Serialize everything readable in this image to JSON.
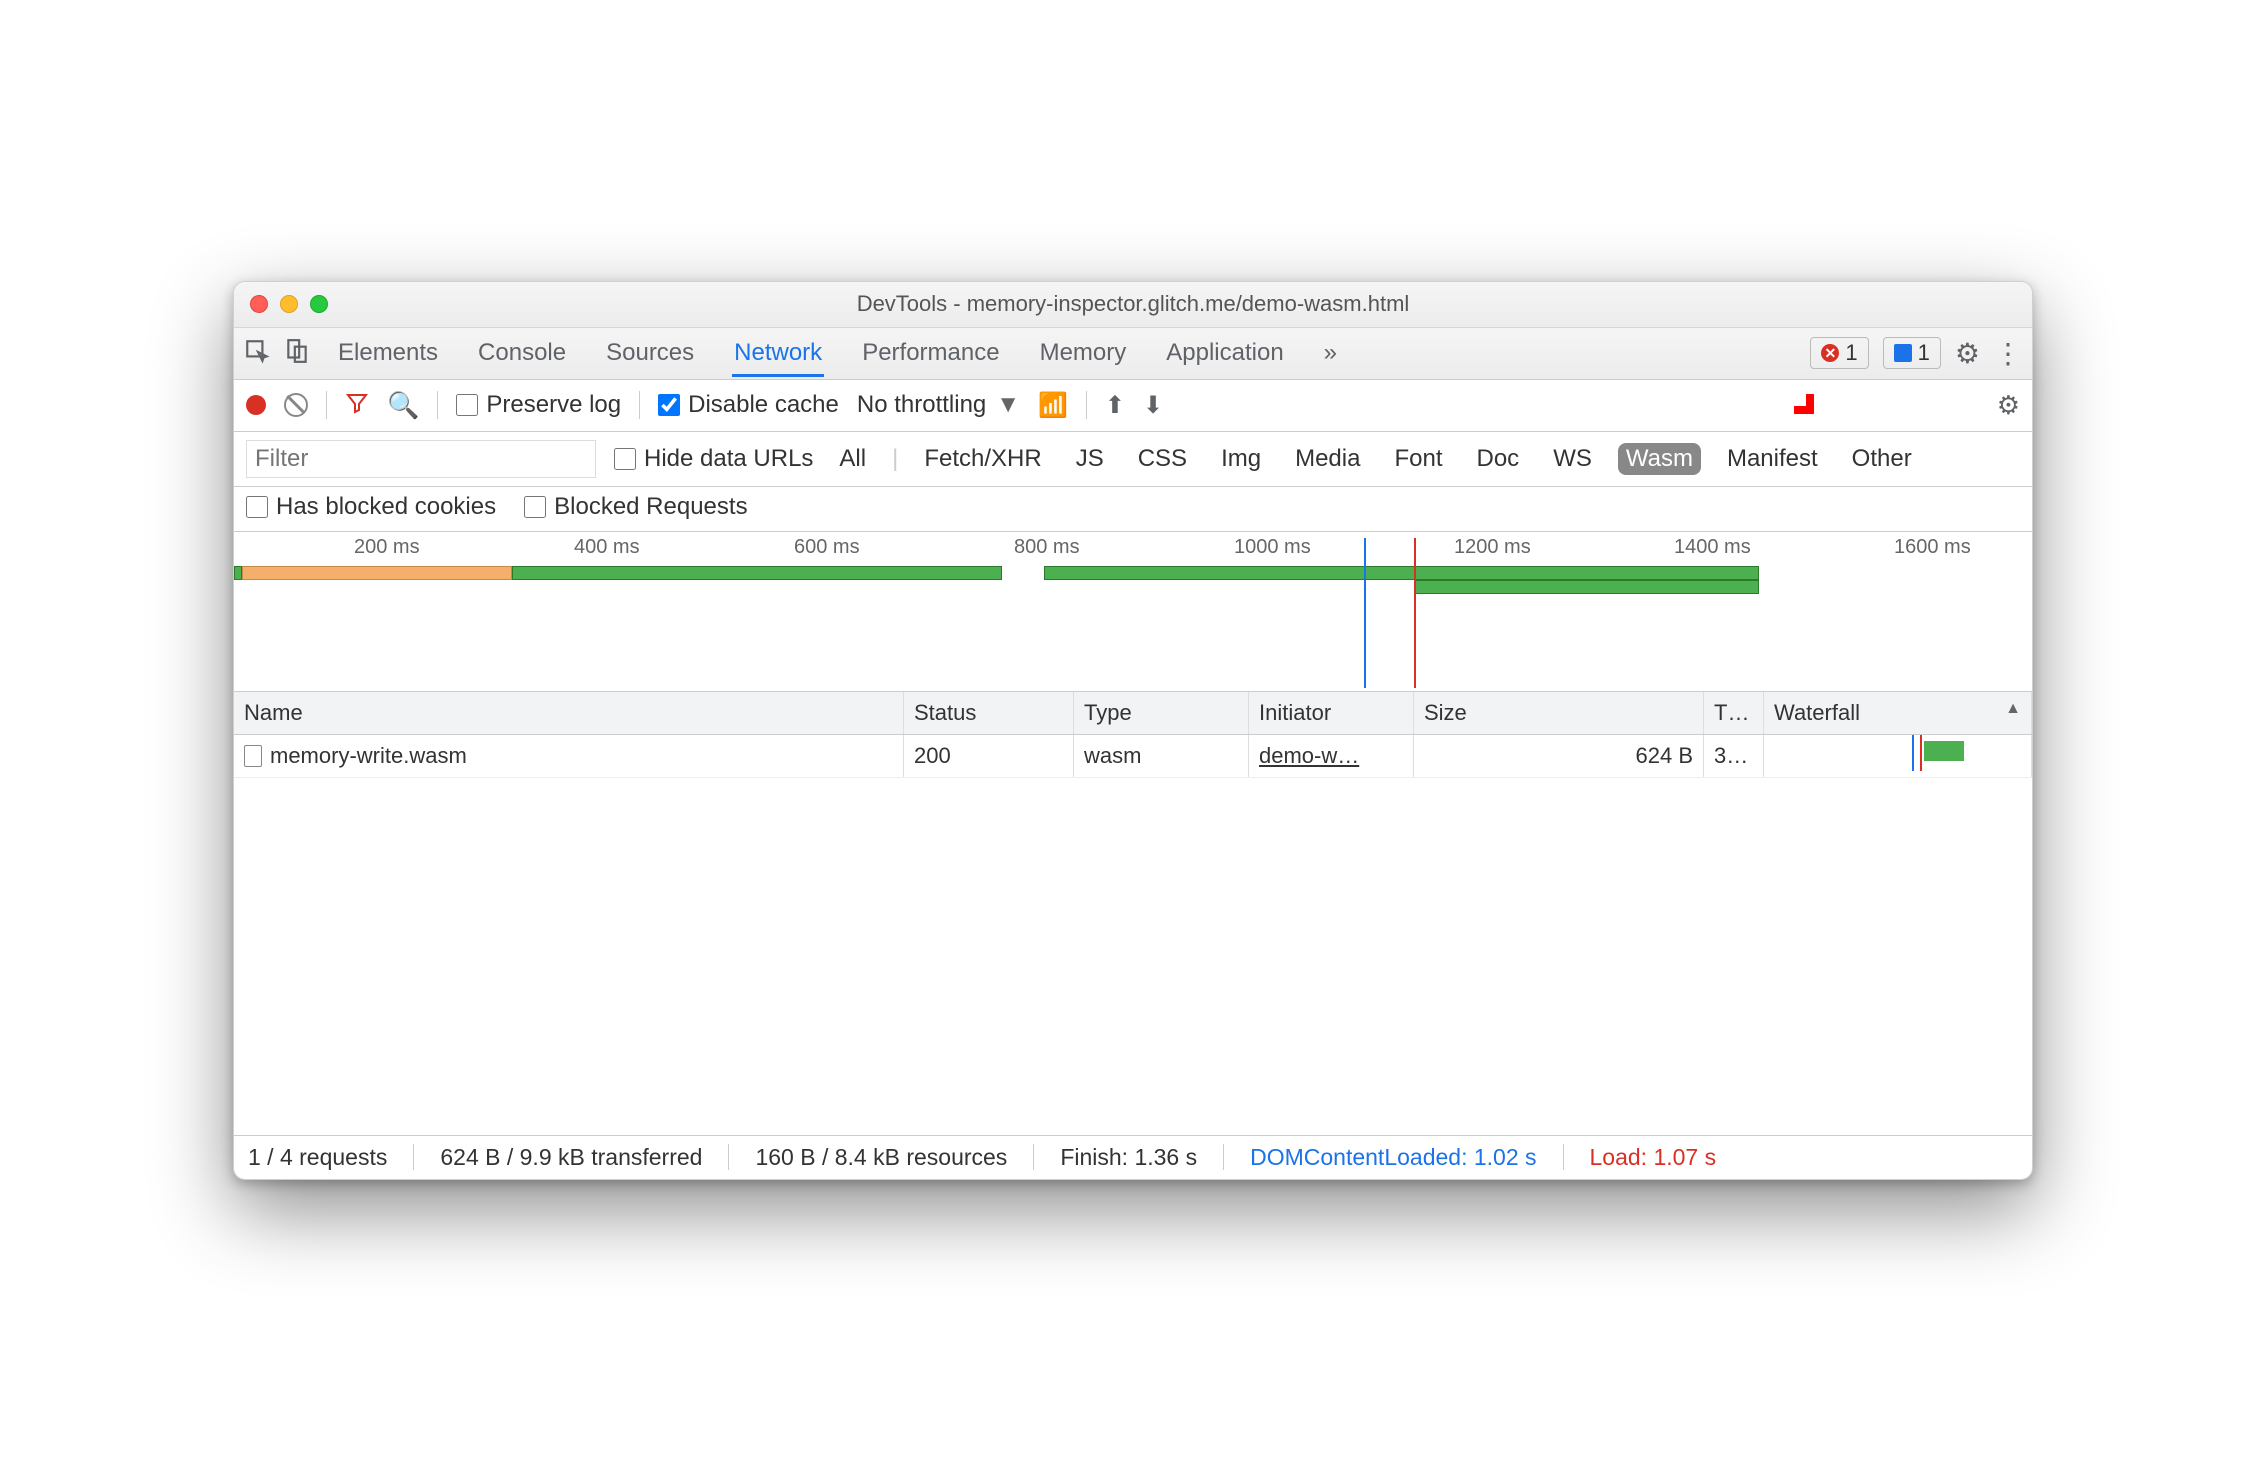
{
  "window_title": "DevTools - memory-inspector.glitch.me/demo-wasm.html",
  "main_tabs": [
    "Elements",
    "Console",
    "Sources",
    "Network",
    "Performance",
    "Memory",
    "Application"
  ],
  "active_tab": "Network",
  "error_count": "1",
  "message_count": "1",
  "toolbar": {
    "preserve_log": "Preserve log",
    "disable_cache": "Disable cache",
    "throttling": "No throttling"
  },
  "filter": {
    "placeholder": "Filter",
    "hide_data_urls": "Hide data URLs",
    "types": [
      "All",
      "Fetch/XHR",
      "JS",
      "CSS",
      "Img",
      "Media",
      "Font",
      "Doc",
      "WS",
      "Wasm",
      "Manifest",
      "Other"
    ],
    "active_type": "Wasm",
    "has_blocked_cookies": "Has blocked cookies",
    "blocked_requests": "Blocked Requests"
  },
  "timeline_ticks": [
    "200 ms",
    "400 ms",
    "600 ms",
    "800 ms",
    "1000 ms",
    "1200 ms",
    "1400 ms",
    "1600 ms"
  ],
  "columns": {
    "name": "Name",
    "status": "Status",
    "type": "Type",
    "initiator": "Initiator",
    "size": "Size",
    "time": "T…",
    "waterfall": "Waterfall"
  },
  "rows": [
    {
      "name": "memory-write.wasm",
      "status": "200",
      "type": "wasm",
      "initiator": "demo-w…",
      "size": "624 B",
      "time": "3…"
    }
  ],
  "footer": {
    "requests": "1 / 4 requests",
    "transferred": "624 B / 9.9 kB transferred",
    "resources": "160 B / 8.4 kB resources",
    "finish": "Finish: 1.36 s",
    "dcl": "DOMContentLoaded: 1.02 s",
    "load": "Load: 1.07 s"
  }
}
